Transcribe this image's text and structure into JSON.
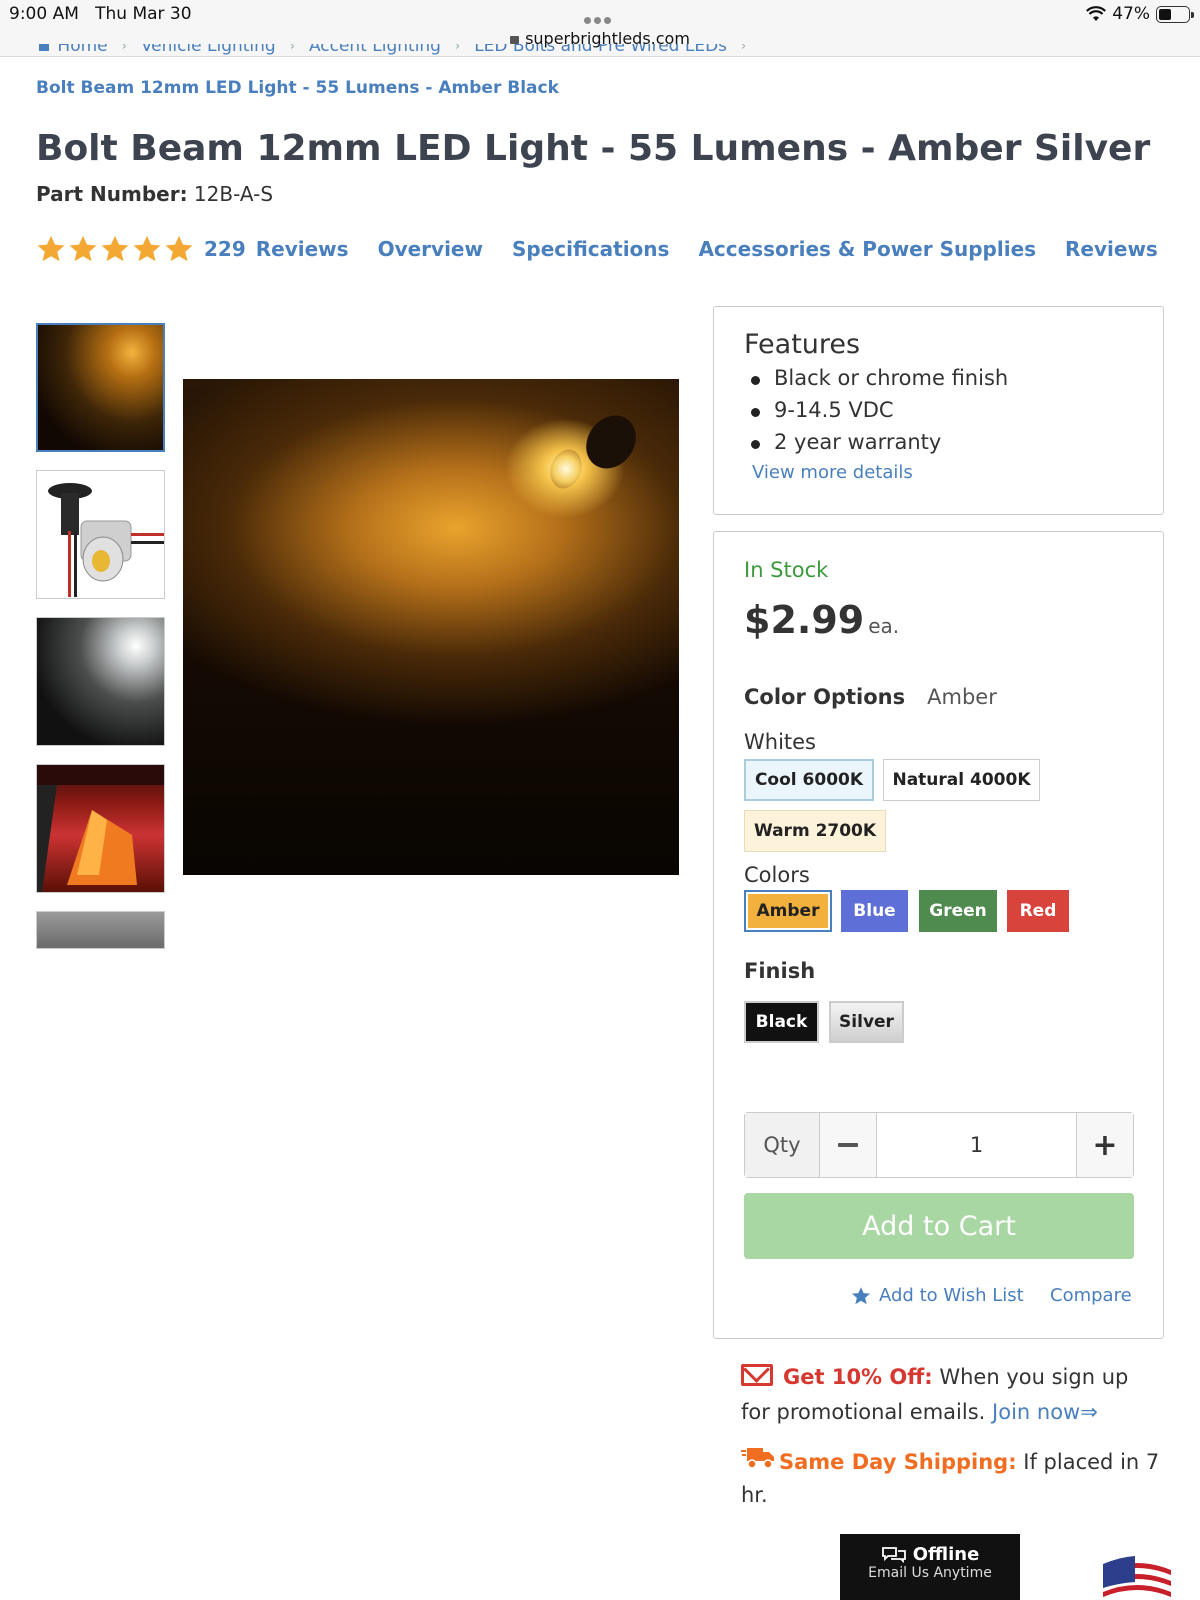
{
  "status_bar": {
    "time": "9:00 AM",
    "date": "Thu Mar 30",
    "url": "superbrightleds.com",
    "battery": "47%"
  },
  "breadcrumb": {
    "items": [
      "Home",
      "Vehicle Lighting",
      "Accent Lighting",
      "LED Bolts and Pre Wired LEDs"
    ],
    "current": "Bolt Beam 12mm LED Light - 55 Lumens - Amber Black"
  },
  "product": {
    "title": "Bolt Beam 12mm LED Light - 55 Lumens - Amber Silver",
    "part_label": "Part Number:",
    "part_number": "12B-A-S",
    "rating_stars": 5,
    "review_count": "229",
    "reviews_label": "Reviews"
  },
  "nav_links": [
    "Overview",
    "Specifications",
    "Accessories & Power Supplies",
    "Reviews"
  ],
  "features": {
    "heading": "Features",
    "items": [
      "Black or chrome finish",
      "9-14.5 VDC",
      "2 year warranty"
    ],
    "more": "View more details"
  },
  "buy": {
    "stock": "In Stock",
    "price": "$2.99",
    "unit": "ea.",
    "color_options_label": "Color Options",
    "color_selected": "Amber",
    "whites_label": "Whites",
    "whites": [
      "Cool 6000K",
      "Natural 4000K",
      "Warm 2700K"
    ],
    "colors_label": "Colors",
    "colors": [
      "Amber",
      "Blue",
      "Green",
      "Red"
    ],
    "finish_label": "Finish",
    "finishes": [
      "Black",
      "Silver"
    ],
    "qty_label": "Qty",
    "qty_value": "1",
    "add_to_cart": "Add to Cart",
    "wish_list": "Add to Wish List",
    "compare": "Compare"
  },
  "promo": {
    "highlight": "Get 10% Off:",
    "text": "When you sign up for promotional emails.",
    "link": "Join now⇒"
  },
  "shipping": {
    "highlight": "Same Day Shipping:",
    "text": "If placed in 7 hr."
  },
  "chat": {
    "status": "Offline",
    "sub": "Email Us Anytime"
  },
  "colors": {
    "link": "#4a7fbd",
    "stock": "#3c9a3c",
    "star": "#f2a833",
    "promo_red": "#d6372f",
    "ship_orange": "#f06d22"
  }
}
